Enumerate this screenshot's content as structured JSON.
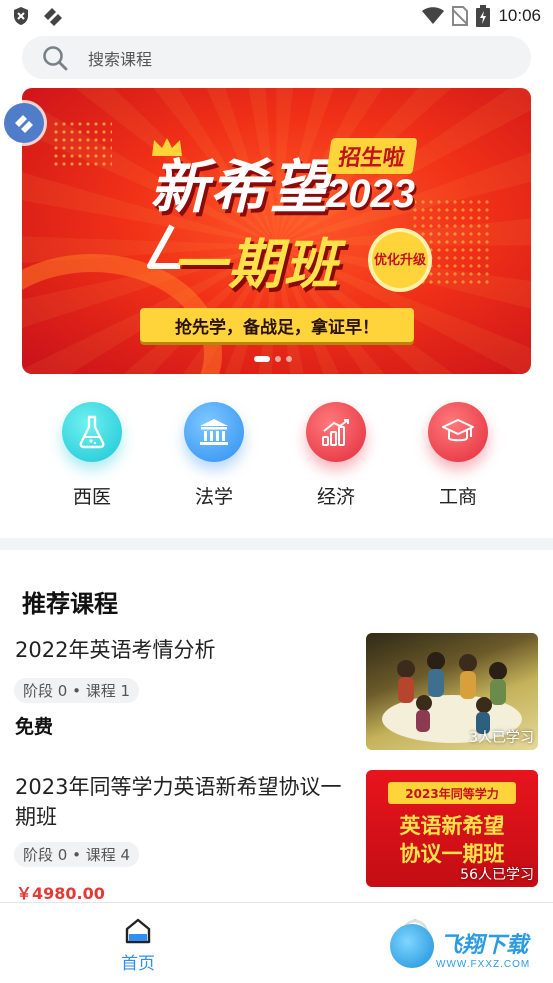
{
  "status_bar": {
    "time": "10:06",
    "icons": [
      "shield-icon",
      "app-badge-icon",
      "wifi-icon",
      "no-sim-icon",
      "battery-icon"
    ]
  },
  "search": {
    "placeholder": "搜索课程"
  },
  "banner": {
    "title_line1": "新希望",
    "tag": "招生啦",
    "year": "2023",
    "title_line2": "一期班",
    "badge": "优化升级",
    "slogan": "抢先学，备战足，拿证早！",
    "slide_index": 1,
    "slide_count": 3
  },
  "categories": [
    {
      "label": "西医",
      "icon": "flask-icon"
    },
    {
      "label": "法学",
      "icon": "courthouse-icon"
    },
    {
      "label": "经济",
      "icon": "growth-chart-icon"
    },
    {
      "label": "工商",
      "icon": "graduation-cap-icon"
    }
  ],
  "section": {
    "title": "推荐课程"
  },
  "courses": [
    {
      "title": "2022年英语考情分析",
      "meta": "阶段 0 • 课程 1",
      "price": "免费",
      "learners": "3人已学习"
    },
    {
      "title": "2023年同等学力英语新希望协议一期班",
      "meta": "阶段 0 • 课程 4",
      "price": "￥4980.00",
      "learners": "56人已学习",
      "thumb_top": "2023年同等学力",
      "thumb_line1": "英语新希望",
      "thumb_line2": "协议一期班"
    }
  ],
  "bottom_nav": {
    "home_label": "首页"
  },
  "watermark": {
    "text": "飞翔下载",
    "url": "WWW.FXXZ.COM"
  },
  "colors": {
    "accent": "#2f8ff2",
    "price": "#e53935",
    "banner_red": "#f03017",
    "banner_yellow": "#ffd43b"
  }
}
